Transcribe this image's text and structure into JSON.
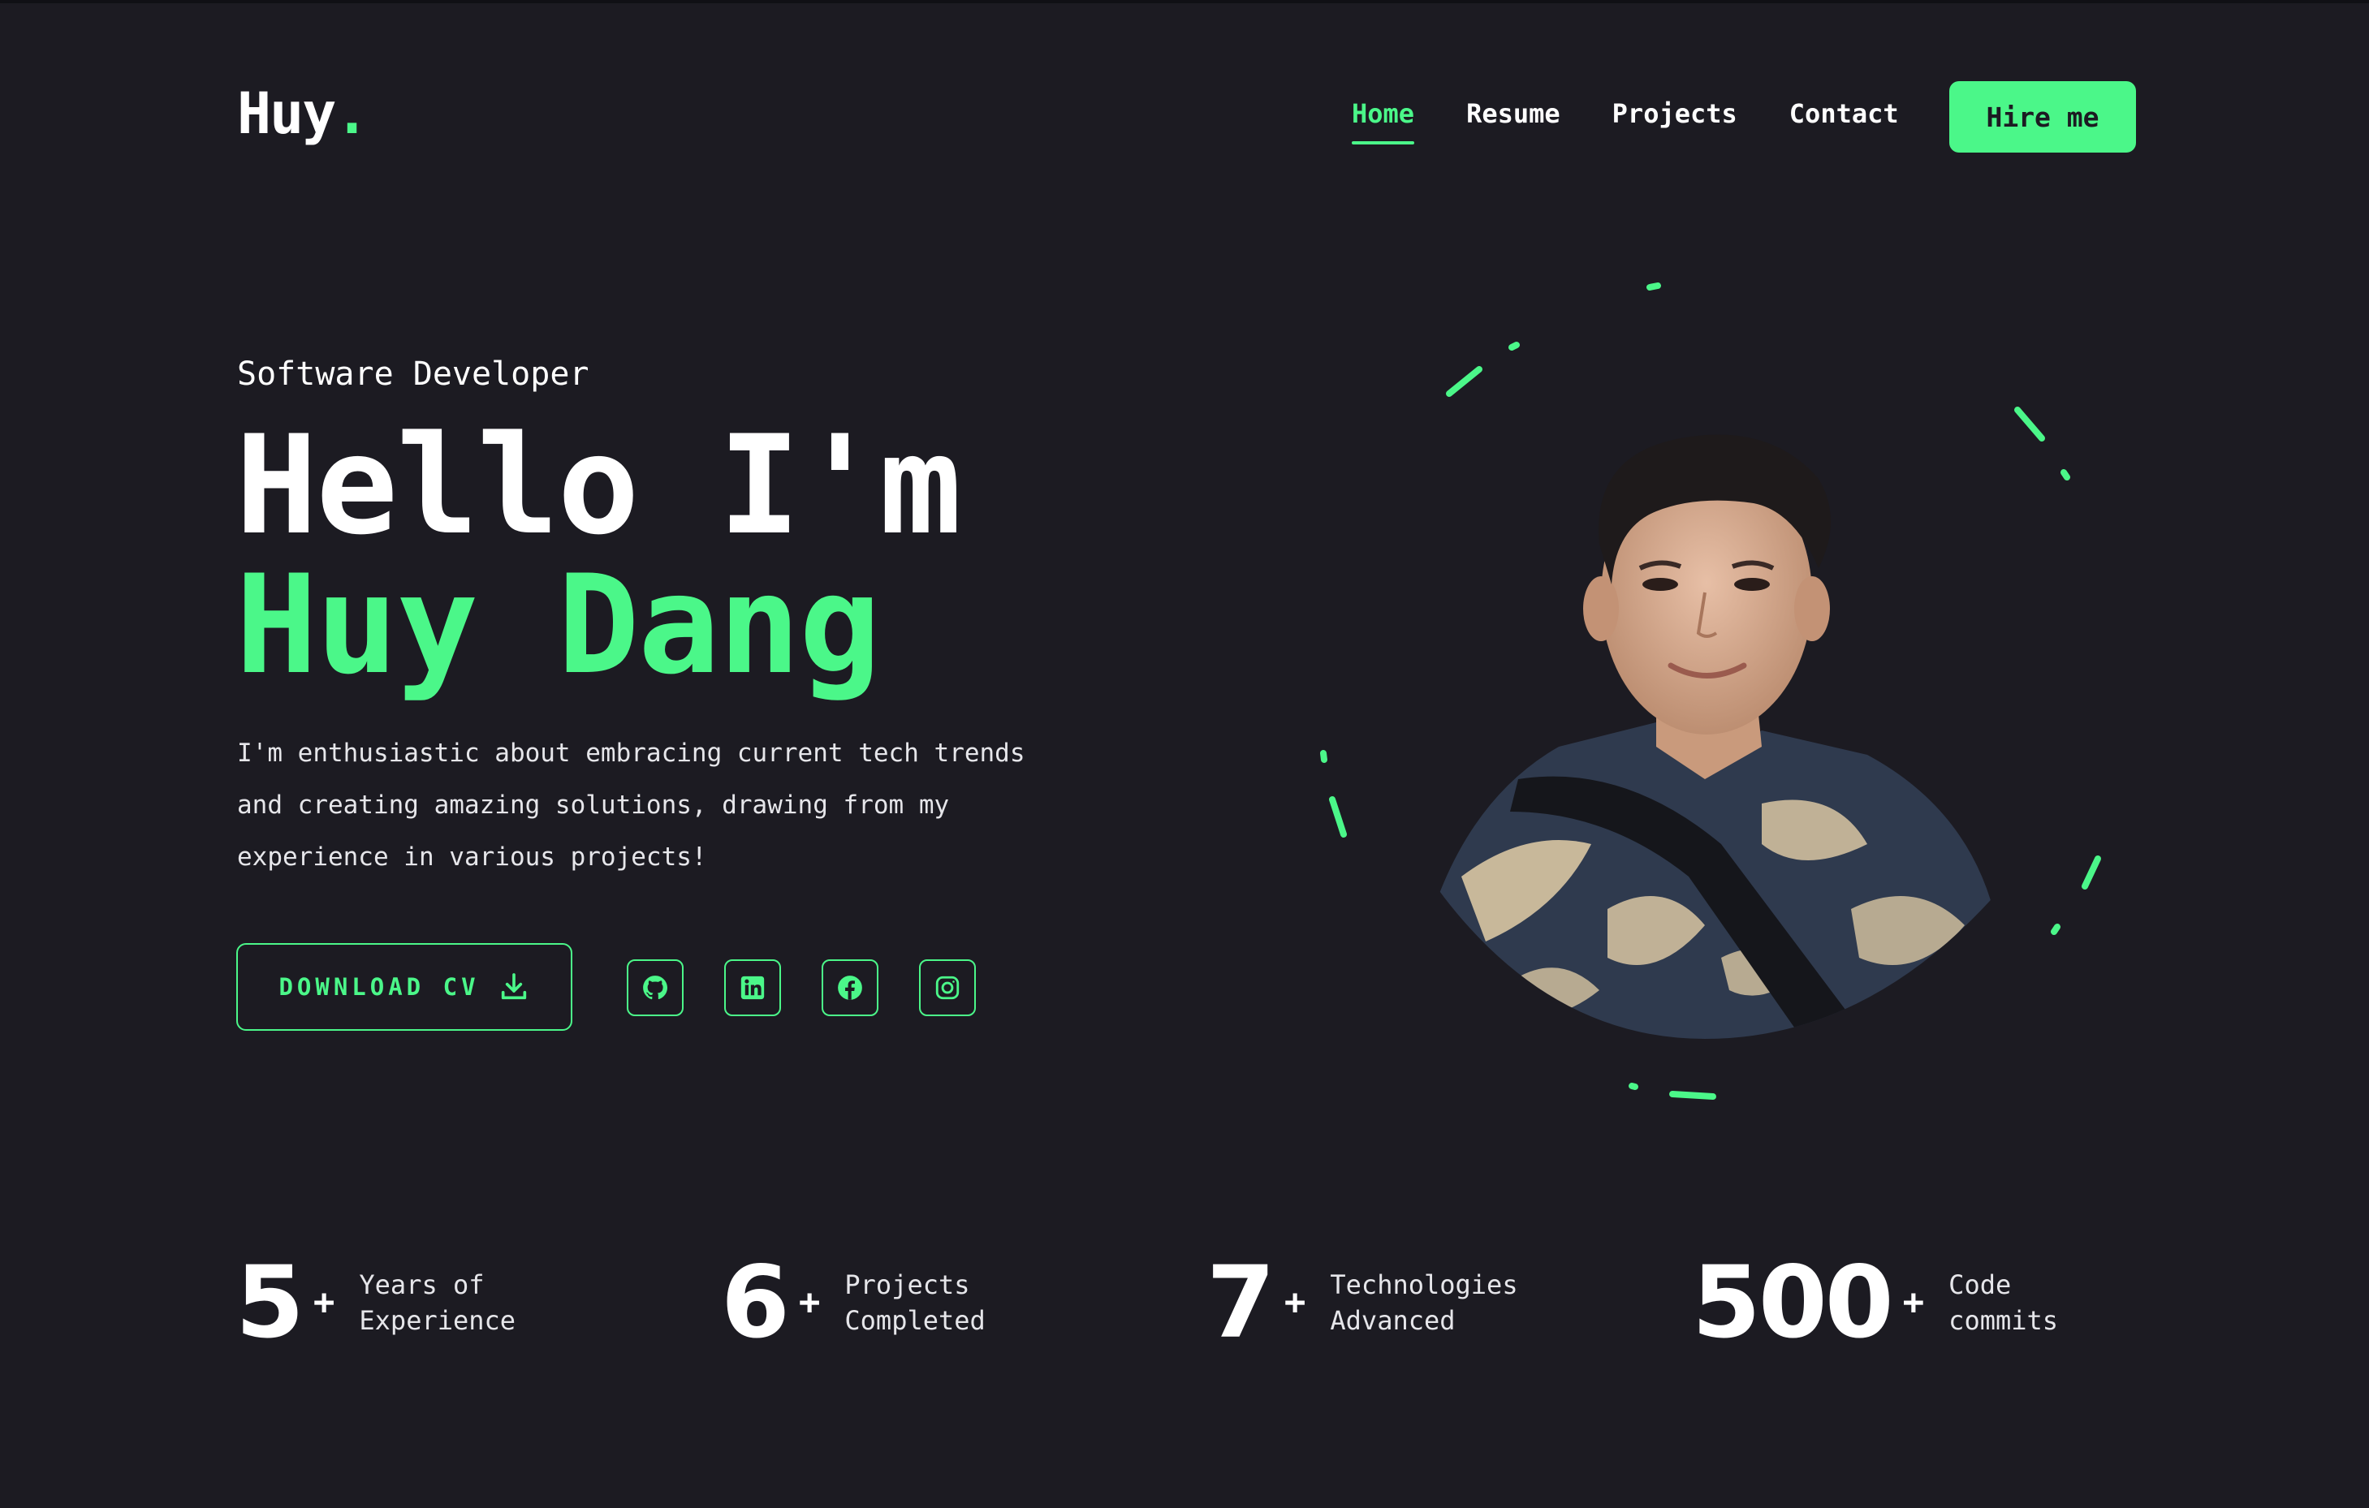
{
  "header": {
    "logo_text": "Huy",
    "logo_dot": ".",
    "nav": [
      {
        "label": "Home"
      },
      {
        "label": "Resume"
      },
      {
        "label": "Projects"
      },
      {
        "label": "Contact"
      }
    ],
    "hire_label": "Hire me"
  },
  "hero": {
    "role": "Software Developer",
    "hello": "Hello I'm",
    "name": "Huy Dang",
    "intro_lines": [
      "I'm enthusiastic about embracing current tech trends",
      "and creating amazing solutions, drawing from my",
      "experience in various projects!"
    ],
    "cv_label": "DOWNLOAD CV",
    "socials": [
      "github-icon",
      "linkedin-icon",
      "facebook-icon",
      "instagram-icon"
    ]
  },
  "stats": [
    {
      "value": "5",
      "plus": "+",
      "label_line1": "Years of",
      "label_line2": "Experience"
    },
    {
      "value": "6",
      "plus": "+",
      "label_line1": "Projects",
      "label_line2": "Completed"
    },
    {
      "value": "7",
      "plus": "+",
      "label_line1": "Technologies",
      "label_line2": "Advanced"
    },
    {
      "value": "500",
      "plus": "+",
      "label_line1": "Code",
      "label_line2": "commits"
    }
  ],
  "colors": {
    "background": "#1c1b22",
    "accent": "#4bf789",
    "text": "#ffffff"
  }
}
